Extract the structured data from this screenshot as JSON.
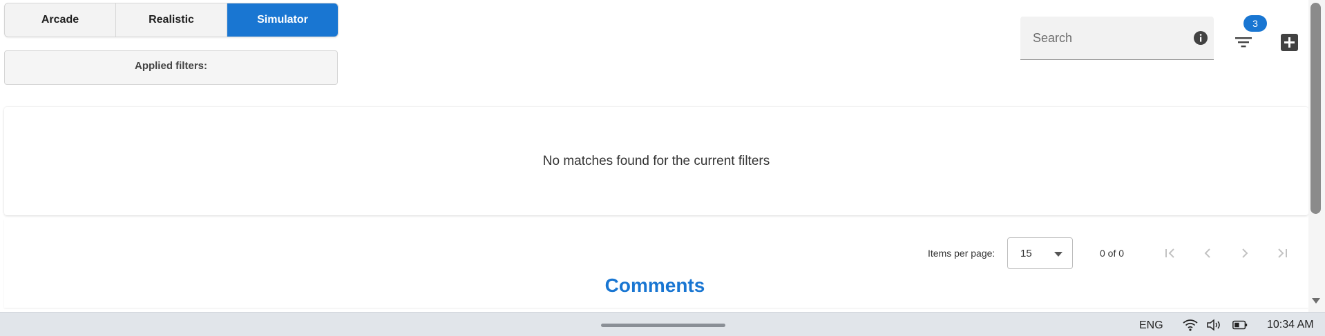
{
  "mode_tabs": [
    {
      "label": "Arcade",
      "active": false
    },
    {
      "label": "Realistic",
      "active": false
    },
    {
      "label": "Simulator",
      "active": true
    }
  ],
  "applied_filters_label": "Applied filters:",
  "search": {
    "placeholder": "Search",
    "value": ""
  },
  "filter_badge_count": "3",
  "results": {
    "empty_message": "No matches found for the current filters"
  },
  "paginator": {
    "items_per_page_label": "Items per page:",
    "items_per_page_value": "15",
    "range_label": "0 of 0"
  },
  "comments_heading": "Comments",
  "taskbar": {
    "language": "ENG",
    "time": "10:34 AM"
  },
  "colors": {
    "accent": "#1976d2"
  },
  "icons": [
    "info-icon",
    "filter-icon",
    "add-icon",
    "first-page-icon",
    "prev-page-icon",
    "next-page-icon",
    "last-page-icon",
    "wifi-icon",
    "volume-icon",
    "battery-icon"
  ]
}
